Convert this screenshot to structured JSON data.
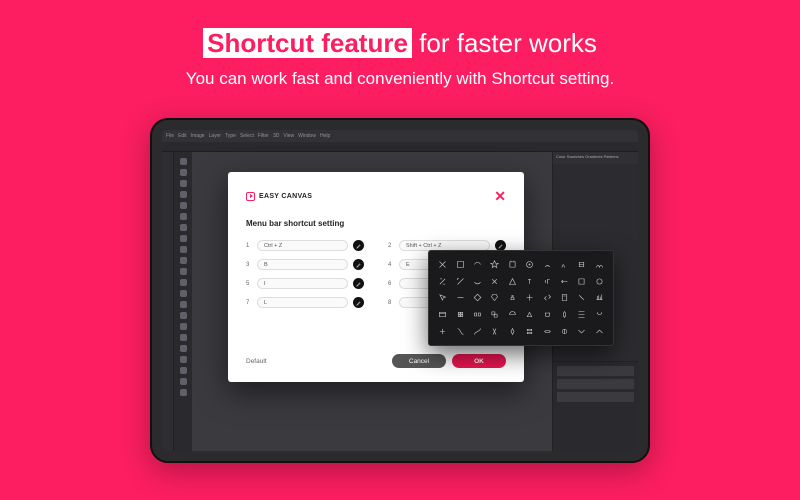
{
  "hero": {
    "highlight": "Shortcut feature",
    "rest": " for faster works",
    "sub": "You can work fast and conveniently with Shortcut setting."
  },
  "app": {
    "menubar": [
      "File",
      "Edit",
      "Image",
      "Layer",
      "Type",
      "Select",
      "Filter",
      "3D",
      "View",
      "Window",
      "Help"
    ],
    "right_panel_tabs": "Color   Swatches   Gradients   Patterns"
  },
  "modal": {
    "brand": "EASY CANVAS",
    "title": "Menu bar shortcut setting",
    "close": "✕",
    "shortcuts": [
      {
        "n": "1",
        "label": "Ctrl + Z"
      },
      {
        "n": "2",
        "label": "Shift + Ctrl + Z"
      },
      {
        "n": "3",
        "label": "B"
      },
      {
        "n": "4",
        "label": "E"
      },
      {
        "n": "5",
        "label": "I"
      },
      {
        "n": "6",
        "label": ""
      },
      {
        "n": "7",
        "label": "L"
      },
      {
        "n": "8",
        "label": ""
      }
    ],
    "default": "Default",
    "cancel": "Cancel",
    "ok": "OK"
  },
  "palette_tools": [
    "move",
    "marquee",
    "lasso",
    "wand",
    "crop",
    "eyedropper",
    "heal",
    "brush",
    "stamp",
    "history",
    "eraser",
    "gradient",
    "blur",
    "dodge",
    "pen",
    "type-h",
    "type-v",
    "path",
    "rect",
    "ellipse",
    "cursor",
    "line",
    "polygon",
    "custom",
    "hand",
    "rotate",
    "zoom",
    "note",
    "count",
    "ruler",
    "frame",
    "artboard",
    "slice",
    "fgbg",
    "mask",
    "3d",
    "cam",
    "light",
    "mesh",
    "material",
    "quick",
    "object",
    "curvature",
    "smudge",
    "sharpen",
    "sponge",
    "patch",
    "magic",
    "pencil",
    "mixer"
  ]
}
